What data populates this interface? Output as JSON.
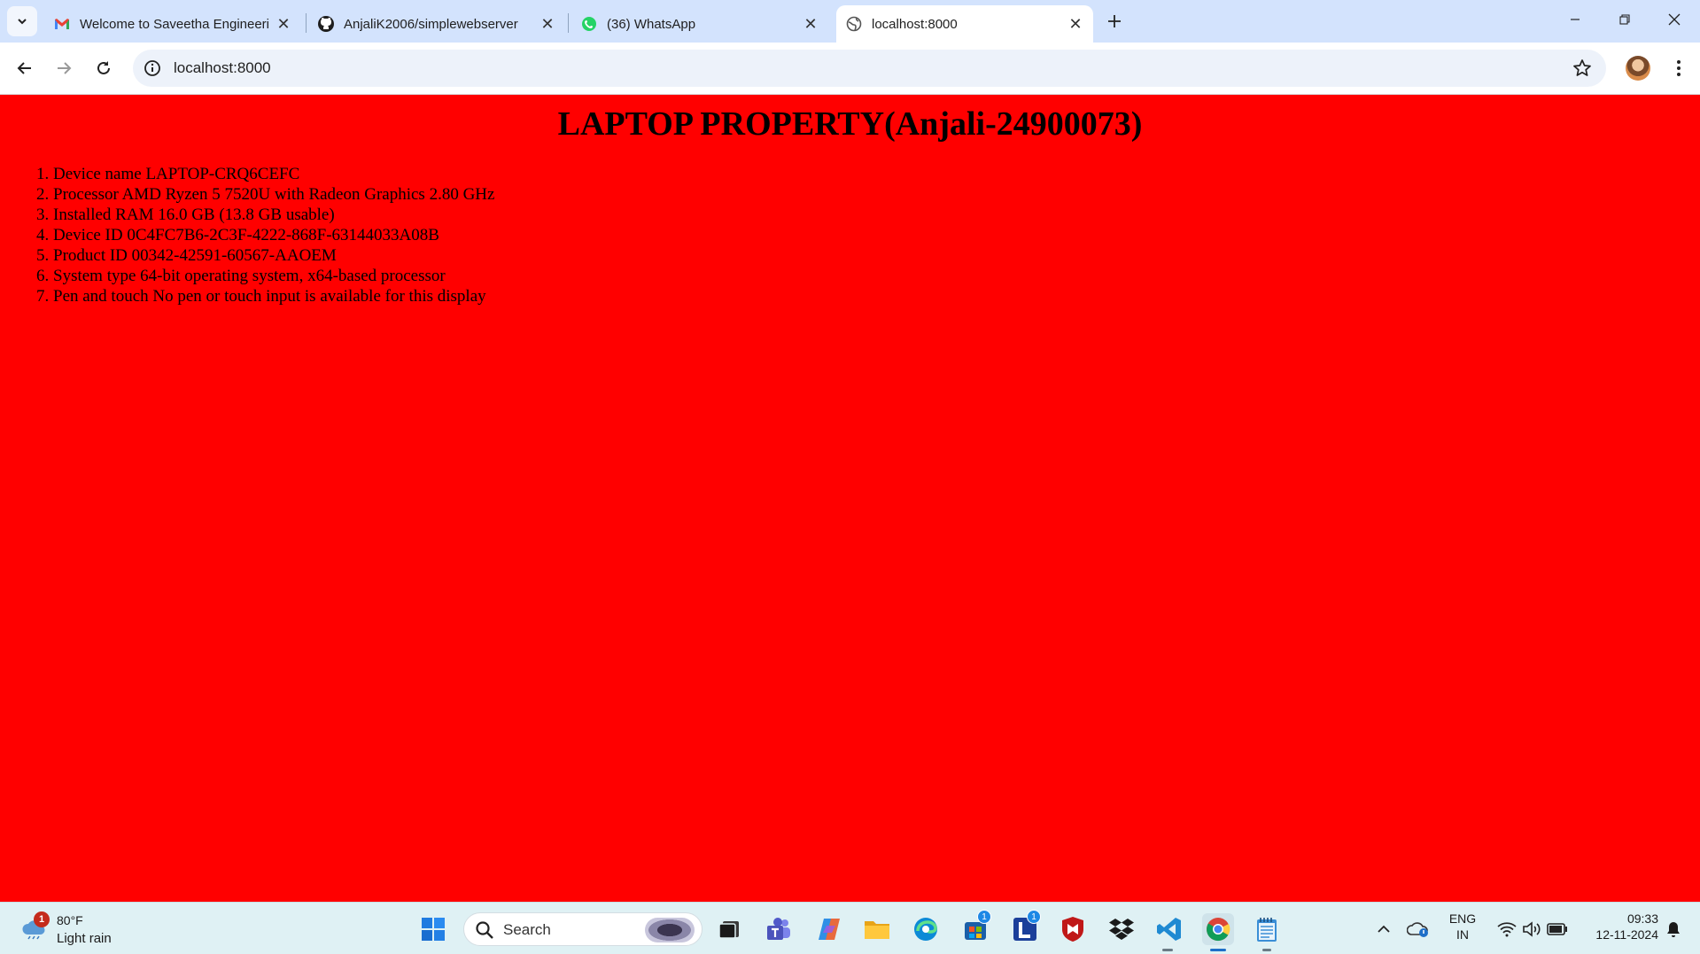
{
  "browser": {
    "tabs": [
      {
        "title": "Welcome to Saveetha Engineeri",
        "favicon": "gmail-icon"
      },
      {
        "title": "AnjaliK2006/simplewebserver",
        "favicon": "github-icon"
      },
      {
        "title": "(36) WhatsApp",
        "favicon": "whatsapp-icon"
      },
      {
        "title": "localhost:8000",
        "favicon": "globe-icon",
        "active": true
      }
    ],
    "address": "localhost:8000"
  },
  "page": {
    "title": "LAPTOP PROPERTY(Anjali-24900073)",
    "background": "#ff0000",
    "items": [
      "Device name LAPTOP-CRQ6CEFC",
      "Processor AMD Ryzen 5 7520U with Radeon Graphics 2.80 GHz",
      "Installed RAM 16.0 GB (13.8 GB usable)",
      "Device ID 0C4FC7B6-2C3F-4222-868F-63144033A08B",
      "Product ID 00342-42591-60567-AAOEM",
      "System type 64-bit operating system, x64-based processor",
      "Pen and touch No pen or touch input is available for this display"
    ]
  },
  "taskbar": {
    "weather": {
      "temp": "80°F",
      "condition": "Light rain",
      "badge": "1"
    },
    "search_label": "Search",
    "teams_badge": "1",
    "lens_badge": "1",
    "language": {
      "line1": "ENG",
      "line2": "IN"
    },
    "time": "09:33",
    "date": "12-11-2024"
  }
}
